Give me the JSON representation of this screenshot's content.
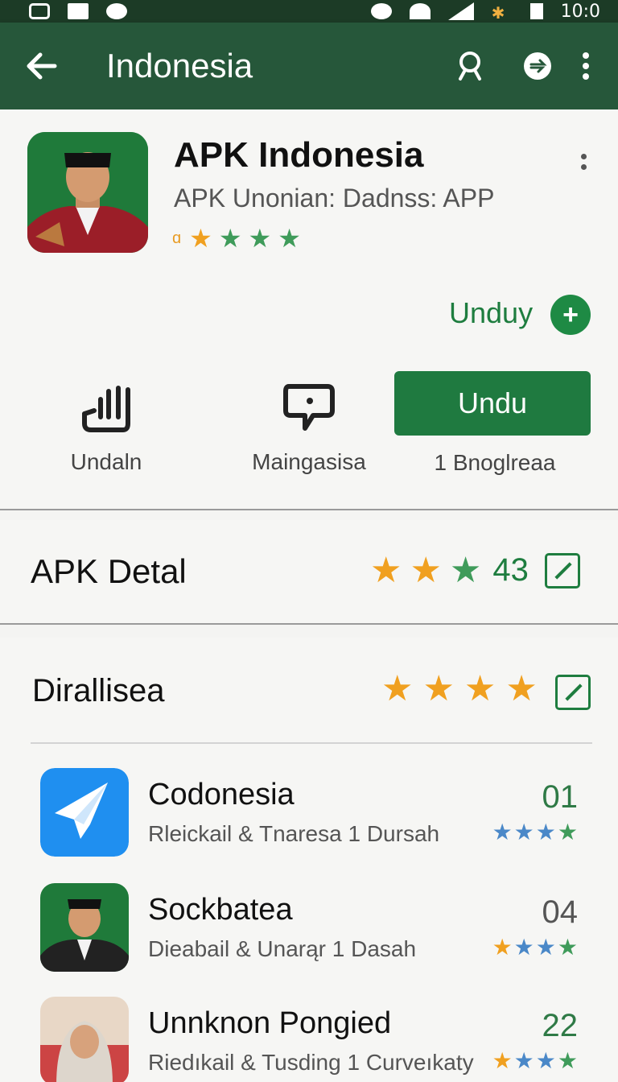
{
  "status_bar": {
    "time": "10:0"
  },
  "app_bar": {
    "title": "Indonesia"
  },
  "app": {
    "name": "APK Indonesia",
    "subtitle": "APK Unonian: Dadnss: APP",
    "rating_prefix": "ɑ",
    "stars": [
      "orange",
      "green",
      "green",
      "green"
    ],
    "download_link": "Unduy",
    "actions": [
      {
        "label": "Undaln",
        "icon": "hand-icon"
      },
      {
        "label": "Maingasisa",
        "icon": "chat-bubble-icon"
      }
    ],
    "install_button": "Undu",
    "install_caption": "1 Bnoglreaa"
  },
  "detail": {
    "title": "APK Detal",
    "stars": [
      "orange",
      "orange",
      "green"
    ],
    "score": "43"
  },
  "list": {
    "title": "Dirallisea",
    "stars": [
      "orange",
      "orange",
      "orange",
      "orange"
    ],
    "items": [
      {
        "title": "Codonesia",
        "subtitle": "Rleickail & Tnaresa 1 Dursah",
        "count": "01",
        "count_color": "#2f7a46",
        "stars": [
          "blue",
          "blue",
          "blue",
          "green"
        ],
        "icon": "paper-plane-icon"
      },
      {
        "title": "Sockbatea",
        "subtitle": "Dieabail & Unarąr 1 Dasah",
        "count": "04",
        "count_color": "#555555",
        "stars": [
          "orange",
          "blue",
          "blue",
          "green"
        ],
        "icon": "avatar-icon"
      },
      {
        "title": "Unnknon Pongied",
        "subtitle": "Riedıkail & Tusding 1 Curveıkaty",
        "count": "22",
        "count_color": "#2f7a46",
        "stars": [
          "orange",
          "blue",
          "blue",
          "green"
        ],
        "icon": "avatar-icon"
      }
    ]
  },
  "colors": {
    "app_bar": "#26573a",
    "accent": "#1e7d3f",
    "star_orange": "#f0a020"
  }
}
